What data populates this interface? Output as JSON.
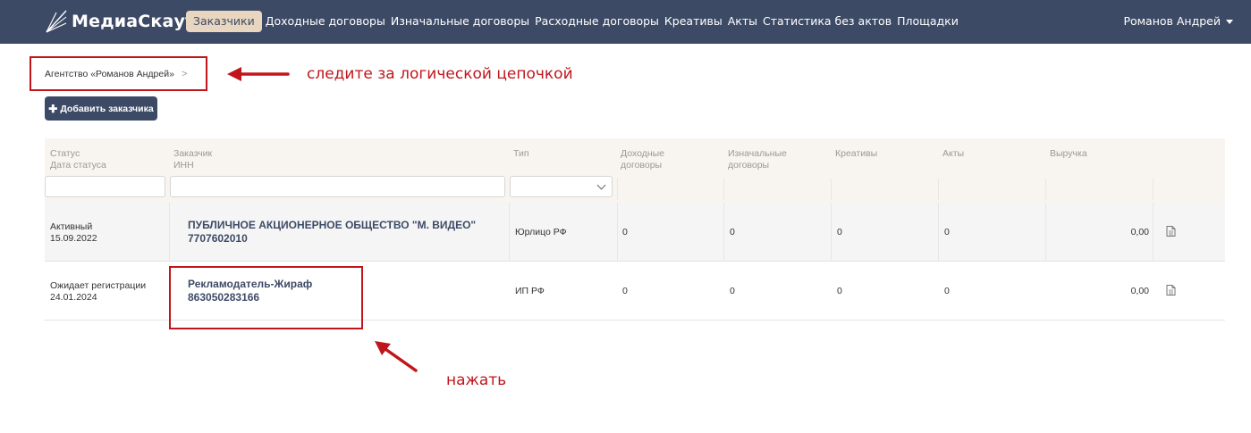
{
  "navbar": {
    "brand": "МедиаСкаут",
    "items": [
      {
        "label": "Заказчики",
        "active": true
      },
      {
        "label": "Доходные договоры",
        "active": false
      },
      {
        "label": "Изначальные договоры",
        "active": false
      },
      {
        "label": "Расходные договоры",
        "active": false
      },
      {
        "label": "Креативы",
        "active": false
      },
      {
        "label": "Акты",
        "active": false
      },
      {
        "label": "Статистика без актов",
        "active": false
      },
      {
        "label": "Площадки",
        "active": false
      }
    ],
    "user": "Романов Андрей"
  },
  "breadcrumb": {
    "item": "Агентство «Романов Андрей»",
    "separator": ">"
  },
  "toolbar": {
    "add_customer": "Добавить заказчика"
  },
  "table": {
    "headers": {
      "status": "Статус",
      "status_date": "Дата статуса",
      "customer": "Заказчик",
      "inn": "ИНН",
      "type": "Тип",
      "income_contracts_1": "Доходные",
      "income_contracts_2": "договоры",
      "initial_contracts_1": "Изначальные",
      "initial_contracts_2": "договоры",
      "creatives": "Креативы",
      "acts": "Акты",
      "revenue": "Выручка"
    },
    "rows": [
      {
        "status": "Активный",
        "date": "15.09.2022",
        "name": "ПУБЛИЧНОЕ АКЦИОНЕРНОЕ ОБЩЕСТВО \"М. ВИДЕО\"",
        "inn": "7707602010",
        "type": "Юрлицо РФ",
        "income": "0",
        "initial": "0",
        "creatives": "0",
        "acts": "0",
        "revenue": "0,00"
      },
      {
        "status": "Ожидает регистрации",
        "date": "24.01.2024",
        "name": "Рекламодатель-Жираф",
        "inn": "863050283166",
        "type": "ИП РФ",
        "income": "0",
        "initial": "0",
        "creatives": "0",
        "acts": "0",
        "revenue": "0,00"
      }
    ]
  },
  "annotations": {
    "chain_hint": "следите за логической цепочкой",
    "click_hint": "нажать"
  },
  "colors": {
    "navbar": "#3d4a66",
    "active_tab": "#e8d6c0",
    "annotation": "#c0161b",
    "header_bg": "#f8f4ef"
  }
}
